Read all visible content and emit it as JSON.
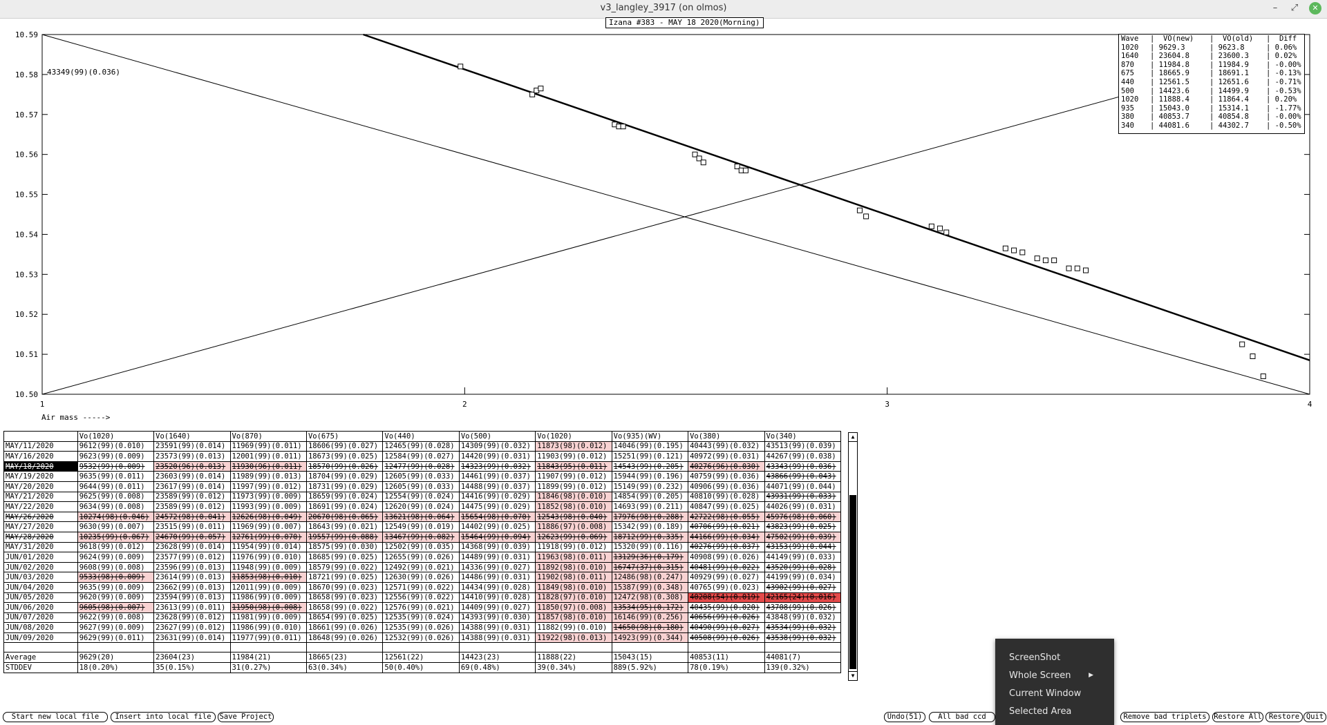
{
  "window": {
    "title": "v3_langley_3917 (on olmos)",
    "min_glyph": "–",
    "max_glyph": "⤢",
    "close_glyph": "✕"
  },
  "plot": {
    "title": "Izana #383 - MAY 18 2020(Morning)",
    "annotation": "43349(99)(0.036)",
    "xlabel": "Air mass ----->"
  },
  "chart_data": {
    "type": "scatter",
    "xlim": [
      1,
      4
    ],
    "ylim": [
      10.5,
      10.59
    ],
    "x_ticks": [
      "1",
      "2",
      "3",
      "4"
    ],
    "y_ticks": [
      "10.50",
      "10.51",
      "10.52",
      "10.53",
      "10.54",
      "10.55",
      "10.56",
      "10.57",
      "10.58",
      "10.59"
    ],
    "points": [
      {
        "x": 1.99,
        "y": 10.582
      },
      {
        "x": 2.16,
        "y": 10.575
      },
      {
        "x": 2.17,
        "y": 10.576
      },
      {
        "x": 2.18,
        "y": 10.5765
      },
      {
        "x": 2.355,
        "y": 10.5675
      },
      {
        "x": 2.365,
        "y": 10.567
      },
      {
        "x": 2.375,
        "y": 10.567
      },
      {
        "x": 2.545,
        "y": 10.56
      },
      {
        "x": 2.555,
        "y": 10.559
      },
      {
        "x": 2.565,
        "y": 10.558
      },
      {
        "x": 2.645,
        "y": 10.557
      },
      {
        "x": 2.655,
        "y": 10.556
      },
      {
        "x": 2.665,
        "y": 10.556
      },
      {
        "x": 2.935,
        "y": 10.546
      },
      {
        "x": 2.95,
        "y": 10.5445
      },
      {
        "x": 3.105,
        "y": 10.542
      },
      {
        "x": 3.125,
        "y": 10.5415
      },
      {
        "x": 3.14,
        "y": 10.5405
      },
      {
        "x": 3.28,
        "y": 10.5365
      },
      {
        "x": 3.3,
        "y": 10.536
      },
      {
        "x": 3.32,
        "y": 10.5355
      },
      {
        "x": 3.355,
        "y": 10.534
      },
      {
        "x": 3.375,
        "y": 10.5335
      },
      {
        "x": 3.395,
        "y": 10.5335
      },
      {
        "x": 3.43,
        "y": 10.5315
      },
      {
        "x": 3.45,
        "y": 10.5315
      },
      {
        "x": 3.47,
        "y": 10.531
      },
      {
        "x": 3.84,
        "y": 10.5125
      },
      {
        "x": 3.865,
        "y": 10.5095
      },
      {
        "x": 3.89,
        "y": 10.5045
      }
    ],
    "fit_line": [
      {
        "x": 1.76,
        "y": 10.59
      },
      {
        "x": 4.0,
        "y": 10.5085
      }
    ],
    "diag_lines": [
      [
        {
          "x": 1.0,
          "y": 10.59
        },
        {
          "x": 4.0,
          "y": 10.5
        }
      ],
      [
        {
          "x": 1.0,
          "y": 10.5
        },
        {
          "x": 3.86,
          "y": 10.5835
        }
      ]
    ]
  },
  "legend": {
    "header": [
      "Wave",
      "|  VO(new)",
      "|  VO(old)",
      "|  Diff"
    ],
    "rows": [
      [
        "1020",
        "| 9629.3",
        "| 9623.8",
        "| 0.06%"
      ],
      [
        "1640",
        "| 23604.8",
        "| 23600.3",
        "| 0.02%"
      ],
      [
        "870",
        "| 11984.8",
        "| 11984.9",
        "| -0.00%"
      ],
      [
        "675",
        "| 18665.9",
        "| 18691.1",
        "| -0.13%"
      ],
      [
        "440",
        "| 12561.5",
        "| 12651.6",
        "| -0.71%"
      ],
      [
        "500",
        "| 14423.6",
        "| 14499.9",
        "| -0.53%"
      ],
      [
        "1020",
        "| 11888.4",
        "| 11864.4",
        "| 0.20%"
      ],
      [
        "935",
        "| 15043.0",
        "| 15314.1",
        "| -1.77%"
      ],
      [
        "380",
        "| 40853.7",
        "| 40854.8",
        "| -0.00%"
      ],
      [
        "340",
        "| 44081.6",
        "| 44302.7",
        "| -0.50%"
      ]
    ]
  },
  "table": {
    "headers": [
      "",
      "Vo(1020)",
      "Vo(1640)",
      "Vo(870)",
      "Vo(675)",
      "Vo(440)",
      "Vo(500)",
      "Vo(1020)",
      "Vo(935)(WV)",
      "Vo(380)",
      "Vo(340)"
    ],
    "rows": [
      [
        "MAY/11/2020",
        "9612(99)(0.010)",
        "23591(99)(0.014)",
        "11969(99)(0.011)",
        "18606(99)(0.027)",
        "12465(99)(0.028)",
        "14309(99)(0.032)",
        "11873(98)(0.012)",
        "14046(99)(0.195)",
        "40443(99)(0.032)",
        "43513(99)(0.039)"
      ],
      [
        "MAY/16/2020",
        "9623(99)(0.009)",
        "23573(99)(0.013)",
        "12001(99)(0.011)",
        "18673(99)(0.025)",
        "12584(99)(0.027)",
        "14420(99)(0.031)",
        "11903(99)(0.012)",
        "15251(99)(0.121)",
        "40972(99)(0.031)",
        "44267(99)(0.038)"
      ],
      [
        "MAY/18/2020",
        "9532(99)(0.009)",
        "23520(96)(0.013)",
        "11930(96)(0.011)",
        "18570(99)(0.026)",
        "12477(99)(0.028)",
        "14323(99)(0.032)",
        "11843(95)(0.011)",
        "14543(99)(0.205)",
        "40276(96)(0.030)",
        "43343(99)(0.036)"
      ],
      [
        "MAY/19/2020",
        "9635(99)(0.011)",
        "23603(99)(0.014)",
        "11989(99)(0.013)",
        "18704(99)(0.029)",
        "12605(99)(0.033)",
        "14461(99)(0.037)",
        "11907(99)(0.012)",
        "15944(99)(0.196)",
        "40759(99)(0.036)",
        "43866(99)(0.043)"
      ],
      [
        "MAY/20/2020",
        "9644(99)(0.011)",
        "23617(99)(0.014)",
        "11997(99)(0.012)",
        "18731(99)(0.029)",
        "12605(99)(0.033)",
        "14488(99)(0.037)",
        "11899(99)(0.012)",
        "15149(99)(0.232)",
        "40906(99)(0.036)",
        "44071(99)(0.044)"
      ],
      [
        "MAY/21/2020",
        "9625(99)(0.008)",
        "23589(99)(0.012)",
        "11973(99)(0.009)",
        "18659(99)(0.024)",
        "12554(99)(0.024)",
        "14416(99)(0.029)",
        "11846(98)(0.010)",
        "14854(99)(0.205)",
        "40810(99)(0.028)",
        "43931(99)(0.033)"
      ],
      [
        "MAY/22/2020",
        "9634(99)(0.008)",
        "23589(99)(0.012)",
        "11993(99)(0.009)",
        "18691(99)(0.024)",
        "12620(99)(0.024)",
        "14475(99)(0.029)",
        "11852(98)(0.010)",
        "14693(99)(0.211)",
        "40847(99)(0.025)",
        "44026(99)(0.031)"
      ],
      [
        "MAY/26/2020",
        "10274(98)(0.046)",
        "24572(98)(0.041)",
        "12626(98)(0.049)",
        "20670(98)(0.065)",
        "13621(98)(0.064)",
        "15654(98)(0.070)",
        "12543(98)(0.040)",
        "17976(98)(0.288)",
        "42722(98)(0.055)",
        "45976(98)(0.060)"
      ],
      [
        "MAY/27/2020",
        "9630(99)(0.007)",
        "23515(99)(0.011)",
        "11969(99)(0.007)",
        "18643(99)(0.021)",
        "12549(99)(0.019)",
        "14402(99)(0.025)",
        "11886(97)(0.008)",
        "15342(99)(0.189)",
        "40706(99)(0.021)",
        "43823(99)(0.025)"
      ],
      [
        "MAY/28/2020",
        "10235(99)(0.067)",
        "24670(99)(0.057)",
        "12761(99)(0.070)",
        "19557(99)(0.088)",
        "13467(99)(0.082)",
        "15464(99)(0.094)",
        "12623(99)(0.069)",
        "18712(99)(0.335)",
        "44166(99)(0.034)",
        "47502(99)(0.039)"
      ],
      [
        "MAY/31/2020",
        "9618(99)(0.012)",
        "23628(99)(0.014)",
        "11954(99)(0.014)",
        "18575(99)(0.030)",
        "12502(99)(0.035)",
        "14368(99)(0.039)",
        "11918(99)(0.012)",
        "15320(99)(0.116)",
        "40276(99)(0.037)",
        "43153(99)(0.044)"
      ],
      [
        "JUN/01/2020",
        "9624(99)(0.009)",
        "23577(99)(0.012)",
        "11976(99)(0.010)",
        "18685(99)(0.025)",
        "12655(99)(0.026)",
        "14489(99)(0.031)",
        "11963(98)(0.011)",
        "13129(36)(0.179)",
        "40908(99)(0.026)",
        "44149(99)(0.033)"
      ],
      [
        "JUN/02/2020",
        "9608(99)(0.008)",
        "23596(99)(0.013)",
        "11948(99)(0.009)",
        "18579(99)(0.022)",
        "12492(99)(0.021)",
        "14336(99)(0.027)",
        "11892(98)(0.010)",
        "16747(37)(0.315)",
        "40481(99)(0.022)",
        "43520(99)(0.028)"
      ],
      [
        "JUN/03/2020",
        "9533(98)(0.009)",
        "23614(99)(0.013)",
        "11853(98)(0.010)",
        "18721(99)(0.025)",
        "12630(99)(0.026)",
        "14486(99)(0.031)",
        "11902(98)(0.011)",
        "12486(98)(0.247)",
        "40929(99)(0.027)",
        "44199(99)(0.034)"
      ],
      [
        "JUN/04/2020",
        "9635(99)(0.009)",
        "23662(99)(0.013)",
        "12011(99)(0.009)",
        "18670(99)(0.023)",
        "12571(99)(0.022)",
        "14434(99)(0.028)",
        "11849(98)(0.010)",
        "15387(99)(0.348)",
        "40765(99)(0.023)",
        "43902(99)(0.027)"
      ],
      [
        "JUN/05/2020",
        "9620(99)(0.009)",
        "23594(99)(0.013)",
        "11986(99)(0.009)",
        "18658(99)(0.023)",
        "12556(99)(0.022)",
        "14410(99)(0.028)",
        "11828(97)(0.010)",
        "12472(98)(0.308)",
        "40208(54)(0.019)",
        "42165(24)(0.016)"
      ],
      [
        "JUN/06/2020",
        "9605(98)(0.007)",
        "23613(99)(0.011)",
        "11950(98)(0.008)",
        "18658(99)(0.022)",
        "12576(99)(0.021)",
        "14409(99)(0.027)",
        "11850(97)(0.008)",
        "13534(95)(0.172)",
        "40435(99)(0.020)",
        "43708(99)(0.026)"
      ],
      [
        "JUN/07/2020",
        "9622(99)(0.008)",
        "23628(99)(0.012)",
        "11981(99)(0.009)",
        "18654(99)(0.025)",
        "12535(99)(0.024)",
        "14393(99)(0.030)",
        "11857(98)(0.010)",
        "16146(99)(0.256)",
        "40656(99)(0.026)",
        "43848(99)(0.032)"
      ],
      [
        "JUN/08/2020",
        "9627(99)(0.009)",
        "23627(99)(0.012)",
        "11986(99)(0.010)",
        "18661(99)(0.026)",
        "12535(99)(0.026)",
        "14388(99)(0.031)",
        "11882(99)(0.010)",
        "14650(98)(0.180)",
        "40490(99)(0.027)",
        "43534(99)(0.032)"
      ],
      [
        "JUN/09/2020",
        "9629(99)(0.011)",
        "23631(99)(0.014)",
        "11977(99)(0.011)",
        "18648(99)(0.026)",
        "12532(99)(0.026)",
        "14388(99)(0.031)",
        "11922(98)(0.013)",
        "14923(99)(0.344)",
        "40508(99)(0.026)",
        "43538(99)(0.032)"
      ]
    ],
    "styles": [
      [
        "",
        "",
        "",
        "",
        "",
        "",
        "",
        "pink",
        "",
        "",
        ""
      ],
      [
        "",
        "",
        "",
        "",
        "",
        "",
        "",
        "",
        "",
        "",
        ""
      ],
      [
        "sel",
        "s",
        "sp",
        "sp",
        "s",
        "s",
        "s",
        "sp",
        "s",
        "sp",
        "s"
      ],
      [
        "",
        "",
        "",
        "",
        "",
        "",
        "",
        "",
        "",
        "",
        "s"
      ],
      [
        "",
        "",
        "",
        "",
        "",
        "",
        "",
        "",
        "",
        "",
        ""
      ],
      [
        "",
        "",
        "",
        "",
        "",
        "",
        "",
        "pink",
        "",
        "",
        "s"
      ],
      [
        "",
        "",
        "",
        "",
        "",
        "",
        "",
        "pink",
        "",
        "",
        ""
      ],
      [
        "s",
        "sp",
        "sp",
        "sp",
        "sp",
        "sp",
        "sp",
        "sp",
        "sp",
        "sp",
        "sp"
      ],
      [
        "",
        "",
        "",
        "",
        "",
        "",
        "",
        "pink",
        "",
        "s",
        "s"
      ],
      [
        "s",
        "sp",
        "sp",
        "sp",
        "sp",
        "sp",
        "sp",
        "sp",
        "sp",
        "sp",
        "sp"
      ],
      [
        "",
        "",
        "",
        "",
        "",
        "",
        "",
        "",
        "",
        "s",
        "s"
      ],
      [
        "",
        "",
        "",
        "",
        "",
        "",
        "",
        "pink",
        "sp",
        "",
        ""
      ],
      [
        "",
        "",
        "",
        "",
        "",
        "",
        "",
        "pink",
        "sp",
        "s",
        "s"
      ],
      [
        "",
        "sp",
        "",
        "sp",
        "",
        "",
        "",
        "pink",
        "pink",
        "",
        ""
      ],
      [
        "",
        "",
        "",
        "",
        "",
        "",
        "",
        "pink",
        "pink",
        "",
        "s"
      ],
      [
        "",
        "",
        "",
        "",
        "",
        "",
        "",
        "pink",
        "pink",
        "red",
        "red"
      ],
      [
        "",
        "sp",
        "",
        "sp",
        "",
        "",
        "",
        "pink",
        "sp",
        "s",
        "s"
      ],
      [
        "",
        "",
        "",
        "",
        "",
        "",
        "",
        "pink",
        "pink",
        "s",
        ""
      ],
      [
        "",
        "",
        "",
        "",
        "",
        "",
        "",
        "",
        "sp",
        "s",
        "s"
      ],
      [
        "",
        "",
        "",
        "",
        "",
        "",
        "",
        "pink",
        "pink",
        "s",
        "s"
      ]
    ],
    "average": [
      "Average",
      "9629(20)",
      "23604(23)",
      "11984(21)",
      "18665(23)",
      "12561(22)",
      "14423(23)",
      "11888(22)",
      "15043(15)",
      "40853(11)",
      "44081(7)"
    ],
    "stddev": [
      "STDDEV",
      "18(0.20%)",
      "35(0.15%)",
      "31(0.27%)",
      "63(0.34%)",
      "50(0.40%)",
      "69(0.48%)",
      "39(0.34%)",
      "889(5.92%)",
      "78(0.19%)",
      "139(0.32%)"
    ]
  },
  "scrollbar": {
    "up_glyph": "▲",
    "down_glyph": "▼"
  },
  "buttons": {
    "start_new": "Start new local file",
    "insert": "Insert into local file",
    "save_project": "Save Project",
    "undo": "Undo(51)",
    "all_bad": "All bad ccd",
    "remove_bad": "Remove bad triplets",
    "restore_all": "Restore All",
    "restore": "Restore",
    "quit": "Quit"
  },
  "context_menu": {
    "items": [
      "ScreenShot",
      "Whole Screen",
      "Current Window",
      "Selected Area"
    ],
    "submenu_arrow": "▶"
  }
}
